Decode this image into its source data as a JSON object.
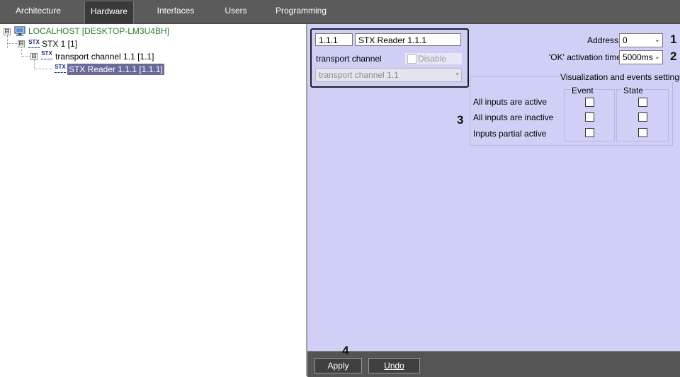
{
  "tabs": [
    {
      "label": "Architecture",
      "active": false
    },
    {
      "label": "Hardware",
      "active": true
    },
    {
      "label": "Interfaces",
      "active": false
    },
    {
      "label": "Users",
      "active": false
    },
    {
      "label": "Programming",
      "active": false
    }
  ],
  "tree": {
    "root": {
      "label": "LOCALHOST [DESKTOP-LM3U4BH]",
      "expander": "⊟"
    },
    "stx": {
      "label": "STX 1 [1]",
      "expander": "⊟",
      "icon_text": "STX"
    },
    "channel": {
      "label": "transport channel 1.1 [1.1]",
      "expander": "⊟",
      "icon_text": "STX"
    },
    "reader": {
      "label": "STX Reader 1.1.1 [1.1.1]",
      "icon_text": "STX"
    }
  },
  "device": {
    "id": "1.1.1",
    "name": "STX Reader 1.1.1",
    "transport_label": "transport channel",
    "disable_label": "Disable",
    "transport_value": "transport channel 1.1"
  },
  "settings": {
    "address_label": "Address:",
    "address_value": "0",
    "ok_time_label": "'OK' activation time:",
    "ok_time_value": "5000ms",
    "viz_title": "Visualization and events settings",
    "col_event": "Event",
    "col_state": "State",
    "rows": [
      {
        "label": "All inputs are active"
      },
      {
        "label": "All inputs are inactive"
      },
      {
        "label": "Inputs partial active"
      }
    ]
  },
  "buttons": {
    "apply": "Apply",
    "undo": "Undo"
  },
  "annotations": [
    "1",
    "2",
    "3",
    "4"
  ],
  "colors": {
    "tree_green": "#2e7d32",
    "selection": "#6a6a9a",
    "panel": "#d0d0f6"
  }
}
